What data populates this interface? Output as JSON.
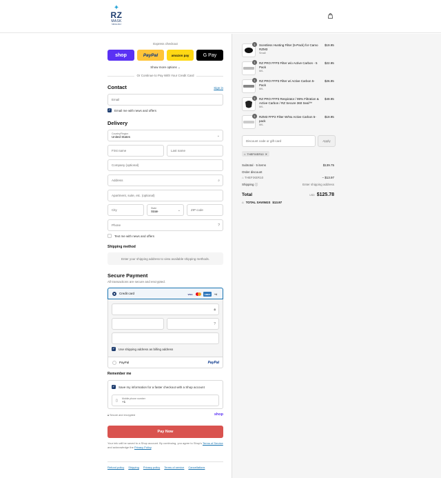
{
  "header": {
    "logo": {
      "line1": "RZ",
      "line2": "MASK",
      "line3": "SINCE 2013"
    }
  },
  "express": {
    "title": "Express checkout",
    "buttons": [
      "shop",
      "PayPal",
      "amazon pay",
      "G Pay"
    ],
    "show_more": "Show more options",
    "or_text": "Or Continue to Pay With Your Credit Card"
  },
  "contact": {
    "title": "Contact",
    "sign_in": "Sign in",
    "email_placeholder": "Email",
    "news_label": "Email me with news and offers"
  },
  "delivery": {
    "title": "Delivery",
    "country_label": "Country/Region",
    "country_value": "United States",
    "first_name": "First name",
    "last_name": "Last name",
    "company": "Company (optional)",
    "address": "Address",
    "apartment": "Apartment, suite, etc. (optional)",
    "city": "City",
    "state_label": "State",
    "state_value": "State",
    "zip": "ZIP code",
    "phone": "Phone",
    "text_label": "Text me with news and offers"
  },
  "shipping": {
    "title": "Shipping method",
    "note": "Enter your shipping address to view available shipping methods."
  },
  "payment": {
    "title": "Secure Payment",
    "subtitle": "All transactions are secure and encrypted.",
    "credit_card": "Credit card",
    "cards": [
      "VISA",
      "AMEX",
      "+4"
    ],
    "use_shipping": "Use shipping address as billing address",
    "paypal": "PayPal",
    "paypal_logo": "PayPal"
  },
  "remember": {
    "title": "Remember me",
    "save_info": "Save my information for a faster checkout with a Shop account",
    "mobile_label": "Mobile phone number",
    "mobile_value": "+1",
    "secure": "Secure and encrypted",
    "shop": "shop"
  },
  "pay_now": "Pay Now",
  "legal": {
    "text1": "Your info will be saved to a Shop account. By continuing, you agree to Shop's",
    "terms": "Terms of Service",
    "and": "and acknowledge the",
    "privacy": "Privacy Policy",
    "end": "."
  },
  "footer": [
    "Refund policy",
    "Shipping",
    "Privacy policy",
    "Terms of service",
    "Cancellations"
  ],
  "cart": {
    "items": [
      {
        "name": "Scentless Hunting Filter (5-Pack) for Camo RZM3",
        "variant": "Small",
        "price": "$19.95",
        "qty": "1"
      },
      {
        "name": "RZ PRO FFP3 Filter w/o Active Carbon - 5 Pack",
        "variant": "M/L",
        "price": "$22.95",
        "qty": "1"
      },
      {
        "name": "RZ PRO FFP3 Filter w/ Active Carbon 5-Pack",
        "variant": "M/L",
        "price": "$26.95",
        "qty": "1"
      },
      {
        "name": "RZ PRO FFP3 Respirator / 99% Filtration & Active Carbon / RZ Secure 360 Seal™",
        "variant": "M/L",
        "price": "$49.95",
        "qty": "1"
      },
      {
        "name": "RZM3 FFP2 Filter W/No Active Carbon 5-pack",
        "variant": "M/L",
        "price": "$19.95",
        "qty": "1"
      }
    ],
    "discount_placeholder": "Discount code or gift card",
    "apply": "Apply",
    "code_tag": "THEFIXER10",
    "subtotal_label": "Subtotal · 5 items",
    "subtotal_value": "$139.75",
    "order_discount_label": "Order discount",
    "discount_code": "THEFIXER10",
    "discount_value": "− $13.97",
    "shipping_label": "Shipping",
    "shipping_value": "Enter shipping address",
    "total_label": "Total",
    "currency": "USD",
    "total_value": "$125.78",
    "savings_label": "TOTAL SAVINGS",
    "savings_value": "$13.97"
  },
  "colors": {
    "accent": "#1773b0",
    "shop": "#5a31f4",
    "pay_now": "#d9534f",
    "brand": "#1d3c6e"
  }
}
